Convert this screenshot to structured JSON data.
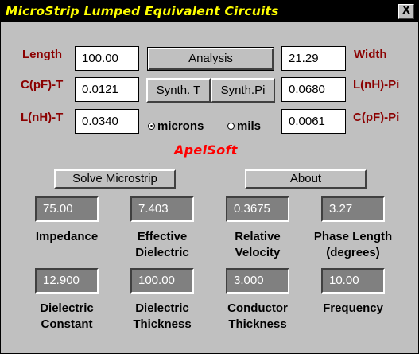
{
  "window": {
    "title": "MicroStrip Lumped Equivalent Circuits",
    "close_glyph": "X"
  },
  "inputs": {
    "length": {
      "label": "Length",
      "value": "100.00"
    },
    "width": {
      "label": "Width",
      "value": "21.29"
    },
    "c_t": {
      "label": "C(pF)-T",
      "value": "0.0121"
    },
    "l_pi": {
      "label": "L(nH)-Pi",
      "value": "0.0680"
    },
    "l_t": {
      "label": "L(nH)-T",
      "value": "0.0340"
    },
    "c_pi": {
      "label": "C(pF)-Pi",
      "value": "0.0061"
    }
  },
  "buttons": {
    "analysis": "Analysis",
    "synth_t": "Synth. T",
    "synth_pi": "Synth.Pi",
    "solve": "Solve Microstrip",
    "about": "About"
  },
  "units": {
    "options": [
      "microns",
      "mils"
    ],
    "selected": "microns"
  },
  "brand": "ApelSoft",
  "results": [
    {
      "value": "75.00",
      "caption1": "Impedance",
      "caption2": ""
    },
    {
      "value": "7.403",
      "caption1": "Effective",
      "caption2": "Dielectric"
    },
    {
      "value": "0.3675",
      "caption1": "Relative",
      "caption2": "Velocity"
    },
    {
      "value": "3.27",
      "caption1": "Phase Length",
      "caption2": "(degrees)"
    }
  ],
  "params": [
    {
      "value": "12.900",
      "caption1": "Dielectric",
      "caption2": "Constant"
    },
    {
      "value": "100.00",
      "caption1": "Dielectric",
      "caption2": "Thickness"
    },
    {
      "value": "3.000",
      "caption1": "Conductor",
      "caption2": "Thickness"
    },
    {
      "value": "10.00",
      "caption1": "Frequency",
      "caption2": ""
    }
  ]
}
